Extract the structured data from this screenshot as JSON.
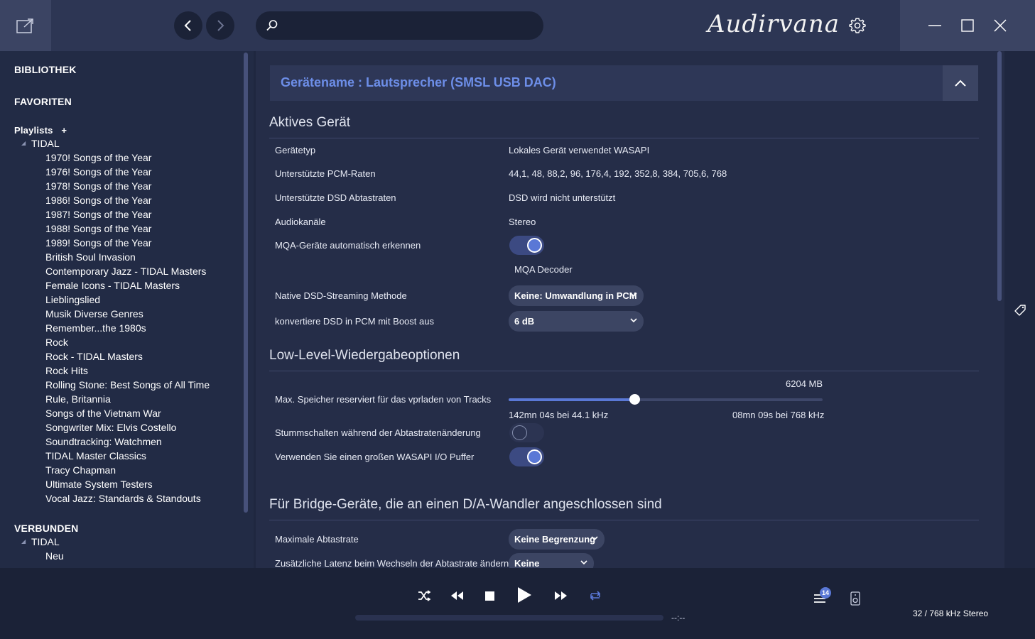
{
  "app": {
    "brand": "Audirvana"
  },
  "search": {
    "placeholder": ""
  },
  "sidebar": {
    "library_label": "BIBLIOTHEK",
    "favorites_label": "FAVORITEN",
    "playlists_label": "Playlists",
    "add_playlist_label": "+",
    "tidal_label": "TIDAL",
    "playlists": [
      "1970! Songs of the Year",
      "1976! Songs of the Year",
      "1978! Songs of the Year",
      "1986! Songs of the Year",
      "1987! Songs of the Year",
      "1988! Songs of the Year",
      "1989! Songs of the Year",
      "British Soul Invasion",
      "Contemporary Jazz - TIDAL Masters",
      "Female Icons - TIDAL Masters",
      "Lieblingslied",
      "Musik Diverse Genres",
      "Remember...the 1980s",
      "Rock",
      "Rock - TIDAL Masters",
      "Rock Hits",
      "Rolling Stone: Best Songs of All Time",
      "Rule, Britannia",
      "Songs of the Vietnam War",
      "Songwriter Mix: Elvis Costello",
      "Soundtracking: Watchmen",
      "TIDAL Master Classics",
      "Tracy Chapman",
      "Ultimate System Testers",
      "Vocal Jazz: Standards & Standouts"
    ],
    "connected_label": "VERBUNDEN",
    "connected_tidal_label": "TIDAL",
    "connected_items": [
      "Neu"
    ]
  },
  "device": {
    "header_title": "Gerätename : Lautsprecher (SMSL USB DAC)",
    "active_section": {
      "title": "Aktives Gerät",
      "device_type_label": "Gerätetyp",
      "device_type_value": "Lokales Gerät verwendet WASAPI",
      "pcm_rates_label": "Unterstützte PCM-Raten",
      "pcm_rates_value": "44,1, 48, 88,2, 96, 176,4, 192, 352,8, 384, 705,6, 768",
      "dsd_rates_label": "Unterstützte DSD Abtastraten",
      "dsd_rates_value": "DSD wird nicht unterstützt",
      "channels_label": "Audiokanäle",
      "channels_value": "Stereo",
      "mqa_label": "MQA-Geräte automatisch erkennen",
      "mqa_on": true,
      "mqa_decoder_label": "MQA Decoder",
      "dsd_method_label": "Native DSD-Streaming Methode",
      "dsd_method_value": "Keine: Umwandlung in PCM",
      "dsd_boost_label": "konvertiere DSD in PCM mit Boost aus",
      "dsd_boost_value": "6 dB"
    },
    "lowlevel_section": {
      "title": "Low-Level-Wiedergabeoptionen",
      "memory_label": "Max. Speicher reserviert für das vprladen von Tracks",
      "memory_value_label": "6204 MB",
      "memory_fraction": 0.4,
      "memory_min_label": "142mn 04s bei 44.1 kHz",
      "memory_max_label": "08mn 09s bei 768 kHz",
      "mute_label": "Stummschalten während der Abtastratenänderung",
      "mute_on": false,
      "wasapi_label": "Verwenden Sie einen großen WASAPI I/O Puffer",
      "wasapi_on": true
    },
    "bridge_section": {
      "title": "Für Bridge-Geräte, die an einen D/A-Wandler angeschlossen sind",
      "max_rate_label": "Maximale Abtastrate",
      "max_rate_value": "Keine Begrenzung",
      "latency_label": "Zusätzliche Latenz beim Wechseln der Abtastrate ändern",
      "latency_value": "Keine"
    }
  },
  "player": {
    "time": "--:--",
    "format": "32 / 768 kHz Stereo",
    "queue_count": "14",
    "progress": 0
  },
  "colors": {
    "accent": "#5a78d6",
    "title_blue": "#6d8ee8",
    "background": "#252d48"
  }
}
